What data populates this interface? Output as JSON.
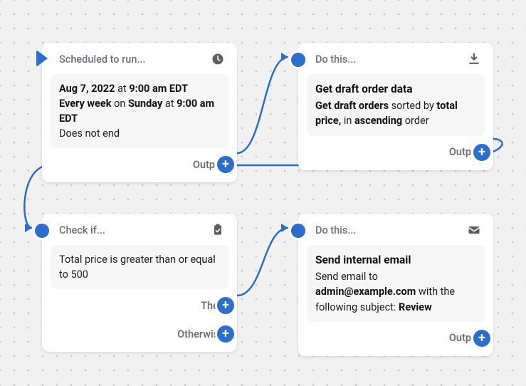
{
  "nodes": {
    "trigger": {
      "header": "Scheduled to run...",
      "date": "Aug 7, 2022",
      "at1": "at",
      "time1": "9:00 am EDT",
      "freq": "Every week",
      "on": "on",
      "day": "Sunday",
      "at2": "at",
      "time2": "9:00 am EDT",
      "noend": "Does not end",
      "output_label": "Output"
    },
    "action1": {
      "header": "Do this...",
      "title": "Get draft order data",
      "p1a": "Get draft orders",
      "p1b": "sorted by",
      "p1c": "total price,",
      "p1d": "in",
      "p1e": "ascending",
      "p1f": "order",
      "output_label": "Output"
    },
    "cond": {
      "header": "Check if...",
      "body": "Total price is greater than or equal to 500",
      "then_label": "Then",
      "else_label": "Otherwise"
    },
    "action2": {
      "header": "Do this...",
      "title": "Send internal email",
      "p1": "Send email to",
      "addr": "admin@example.com",
      "p2": "with the following subject:",
      "subj": "Review",
      "output_label": "Output"
    }
  }
}
